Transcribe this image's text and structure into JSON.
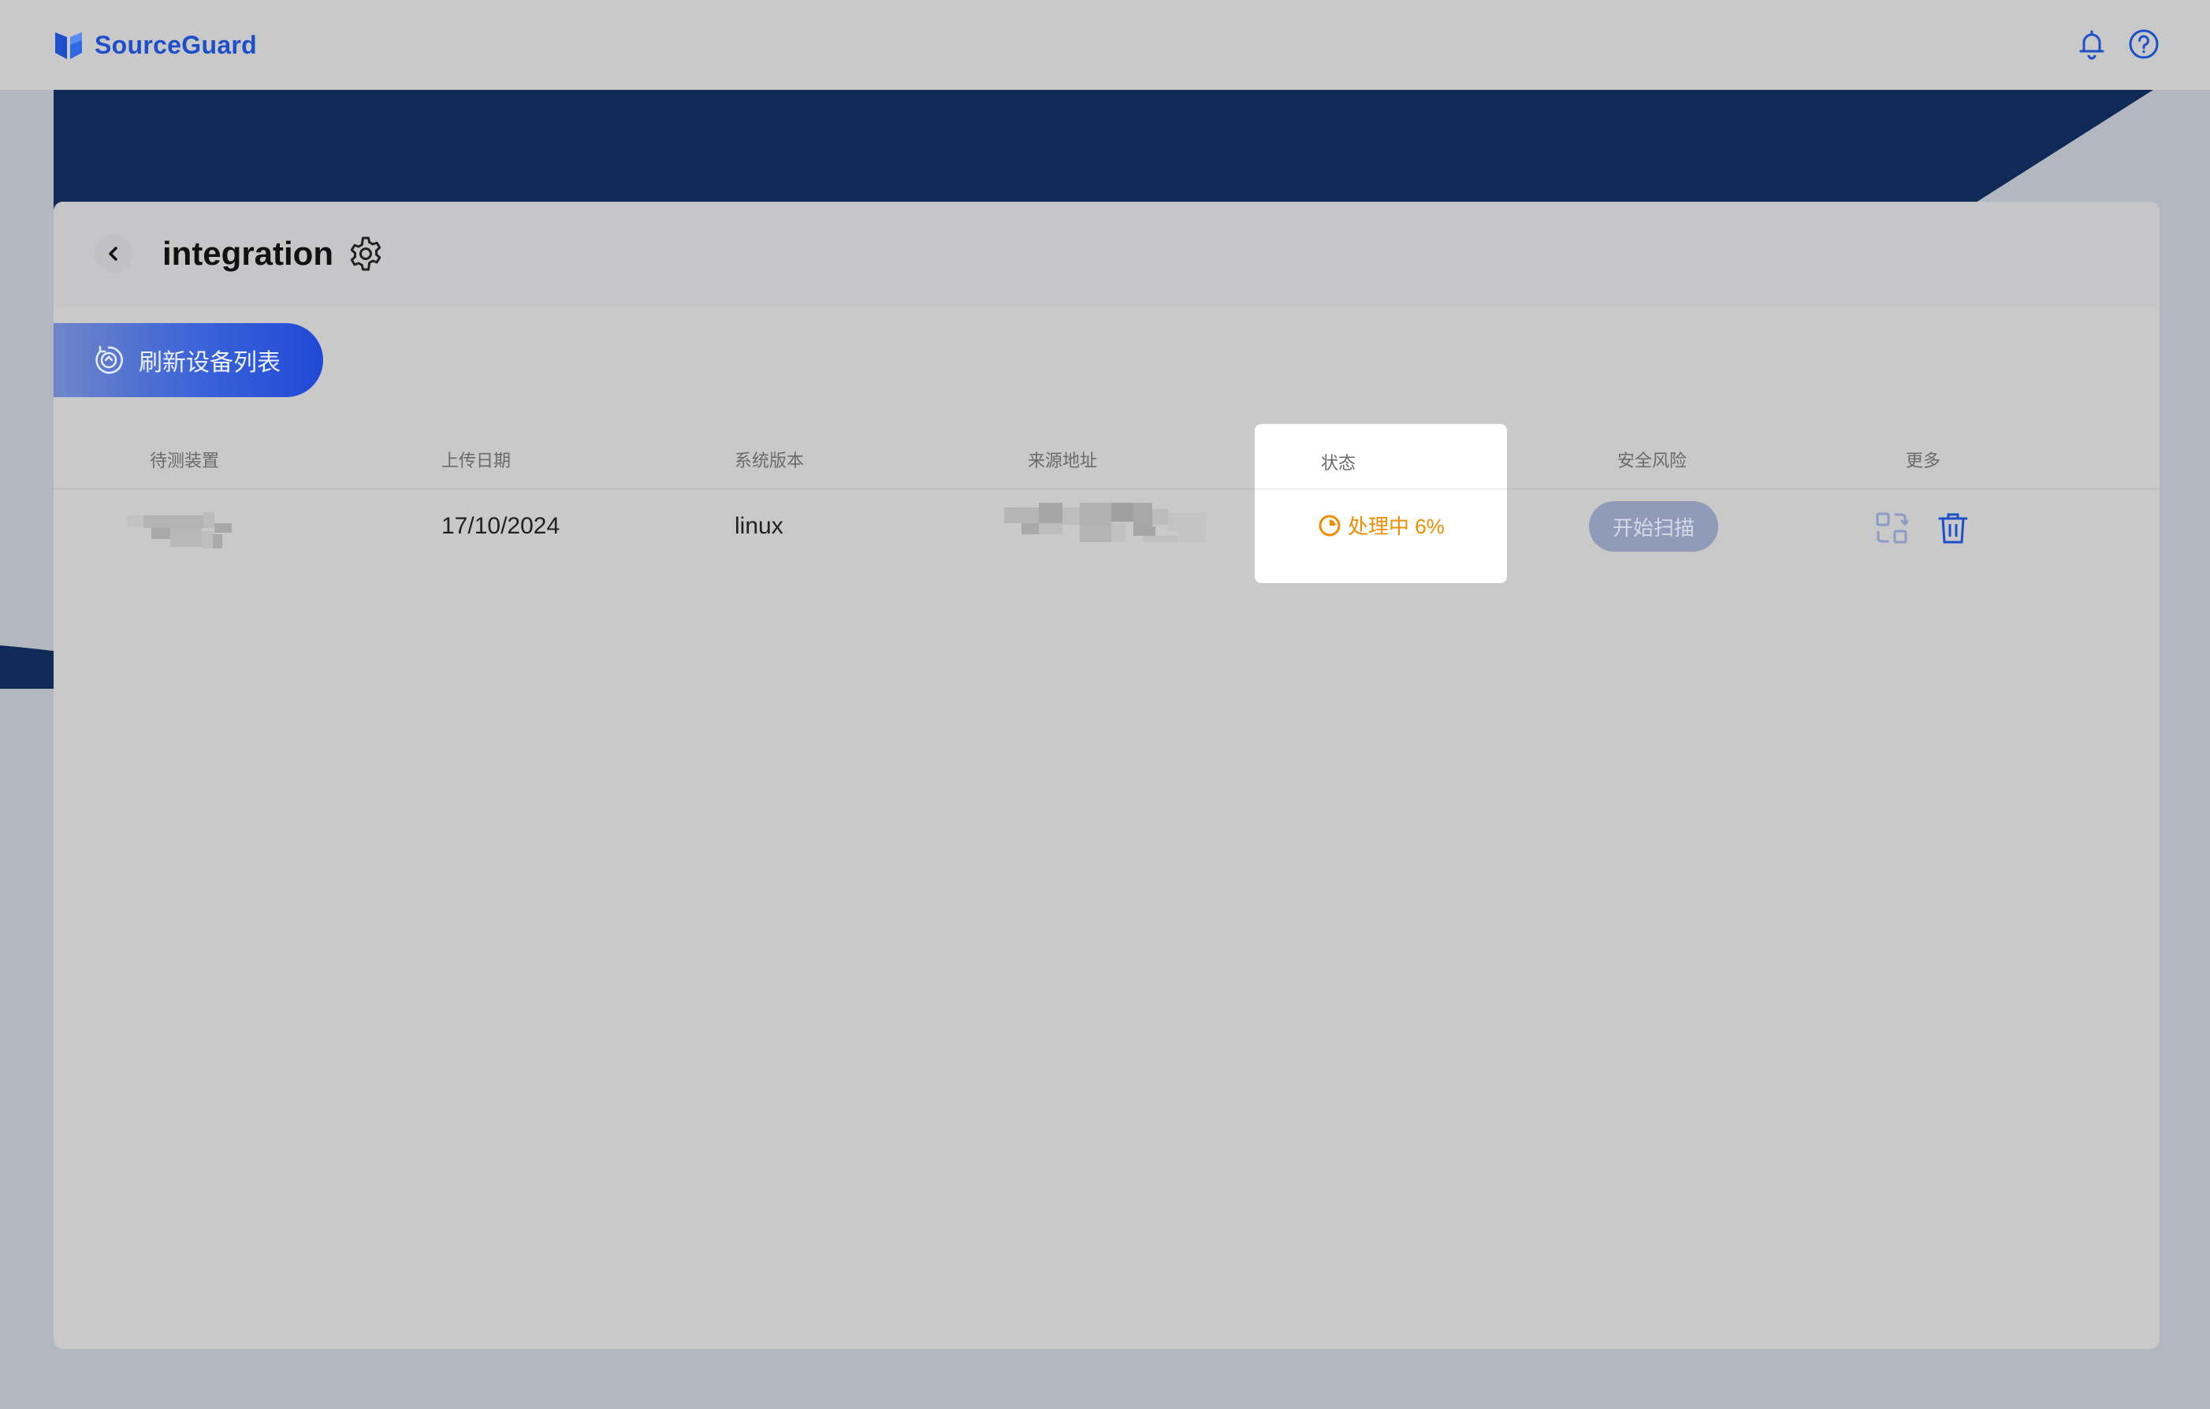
{
  "brand": {
    "name": "SourceGuard",
    "color": "#1d4fc9"
  },
  "header": {
    "icons": [
      "bell-icon",
      "help-icon"
    ]
  },
  "page": {
    "title": "integration"
  },
  "toolbar": {
    "refresh_label": "刷新设备列表"
  },
  "table": {
    "headers": [
      "待测装置",
      "上传日期",
      "系统版本",
      "来源地址",
      "状态",
      "安全风险",
      "更多"
    ],
    "rows": [
      {
        "device": "",
        "upload_date": "17/10/2024",
        "os_version": "linux",
        "source": "",
        "status": "处理中 6%",
        "status_progress": 6,
        "scan_label": "开始扫描"
      }
    ]
  },
  "colors": {
    "navy": "#0f2a56",
    "status_orange": "#f08d00",
    "accent_blue": "#1f49d6"
  }
}
